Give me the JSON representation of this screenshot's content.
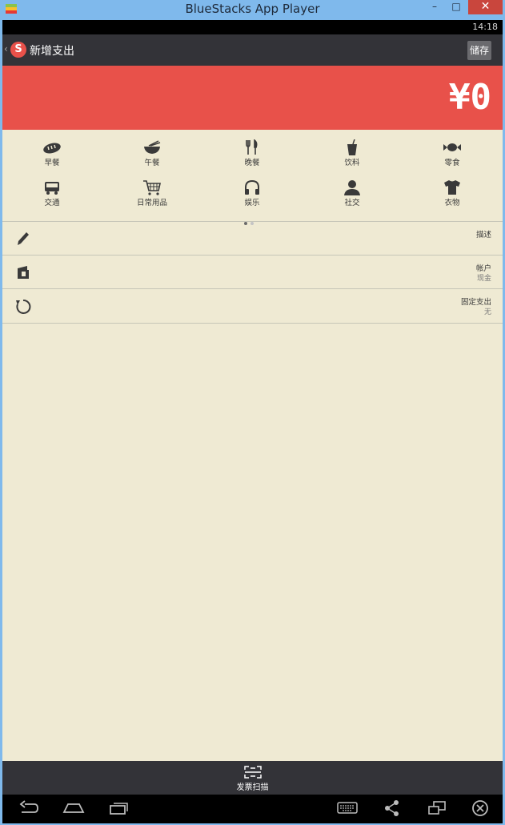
{
  "window": {
    "title": "BlueStacks App Player",
    "minimize": "–",
    "maximize": "□",
    "close": "✕"
  },
  "status": {
    "time": "14:18"
  },
  "appbar": {
    "back": "‹",
    "logo": "S",
    "title": "新增支出",
    "save_label": "储存"
  },
  "amount": {
    "value": "¥0"
  },
  "categories": [
    {
      "label": "早餐",
      "icon": "bread-icon"
    },
    {
      "label": "午餐",
      "icon": "noodle-bowl-icon"
    },
    {
      "label": "晚餐",
      "icon": "fork-knife-icon"
    },
    {
      "label": "饮料",
      "icon": "drink-cup-icon"
    },
    {
      "label": "零食",
      "icon": "candy-icon"
    },
    {
      "label": "交通",
      "icon": "bus-icon"
    },
    {
      "label": "日常用品",
      "icon": "shopping-cart-icon"
    },
    {
      "label": "娱乐",
      "icon": "headphones-icon"
    },
    {
      "label": "社交",
      "icon": "person-icon"
    },
    {
      "label": "衣物",
      "icon": "shirt-icon"
    }
  ],
  "pager": {
    "active_color": "#6a6a6a",
    "inactive_color": "#c4c4c4"
  },
  "fields": {
    "description": {
      "label": "描述",
      "icon": "pencil-icon"
    },
    "account": {
      "label": "帐户",
      "value": "现金",
      "icon": "wallet-icon"
    },
    "recurring": {
      "label": "固定支出",
      "value": "无",
      "icon": "repeat-icon"
    }
  },
  "scan": {
    "label": "发票扫描",
    "icon": "scan-icon"
  },
  "colors": {
    "accent": "#e8514a",
    "bar": "#333338",
    "background": "#efead3",
    "titlebar": "#7fb9ec"
  }
}
